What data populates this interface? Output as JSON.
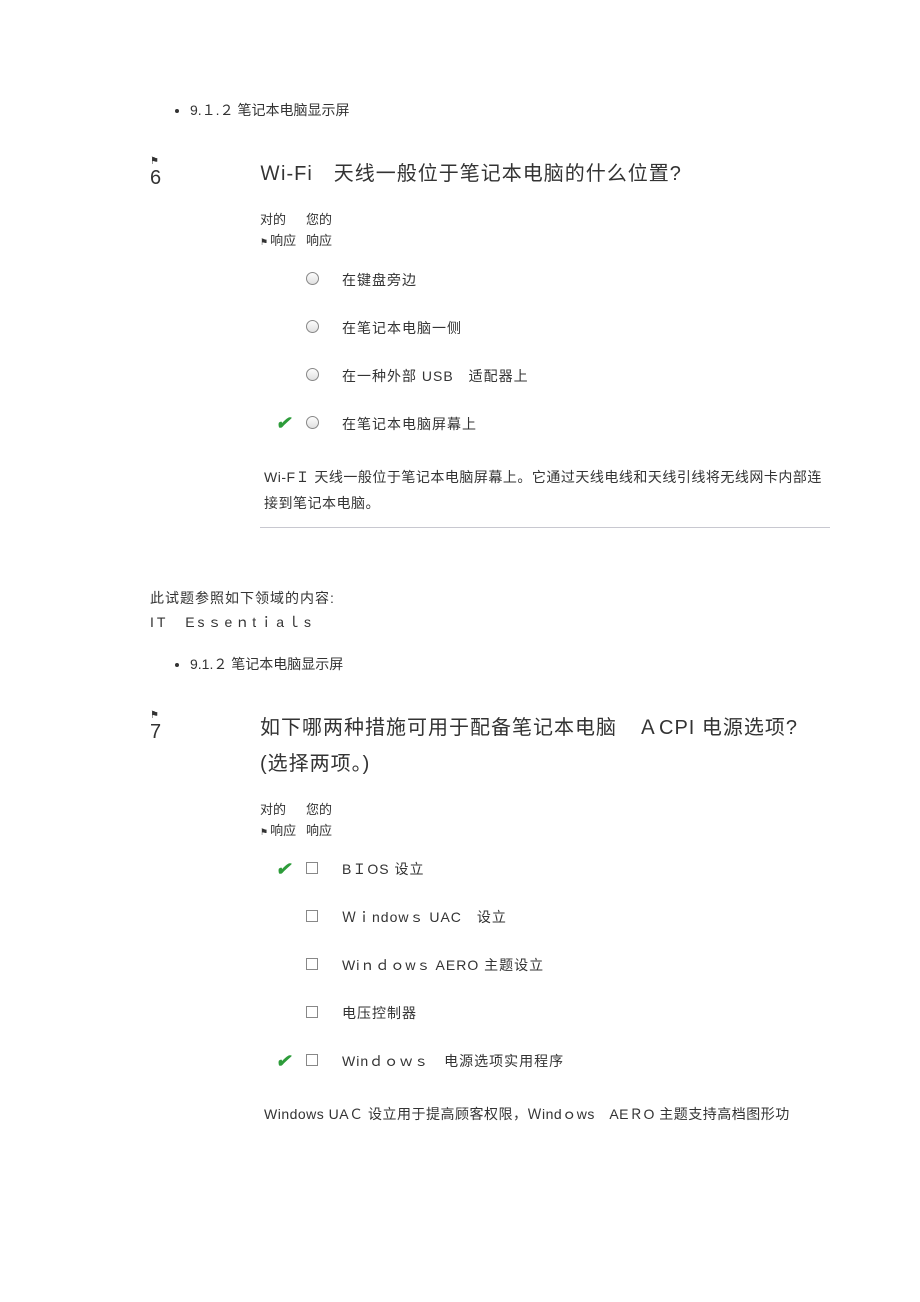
{
  "topBullet": {
    "text": "9.１.２ 笔记本电脑显示屏"
  },
  "q6": {
    "number": "6",
    "title": "Ｗi-Fi　天线一般位于笔记本电脑的什么位置?",
    "headerCorrect": "对的",
    "headerCorrect2": "响应",
    "headerYour": "您的",
    "headerYour2": "响应",
    "options": [
      {
        "correct": false,
        "text": "在键盘旁边"
      },
      {
        "correct": false,
        "text": "在笔记本电脑一侧"
      },
      {
        "correct": false,
        "text": "在一种外部 USB　适配器上"
      },
      {
        "correct": true,
        "text": "在笔记本电脑屏幕上"
      }
    ],
    "explanation": "Wi-FＩ 天线一般位于笔记本电脑屏幕上。它通过天线电线和天线引线将无线网卡内部连接到笔记本电脑。"
  },
  "domain": {
    "intro": "此试题参照如下领域的内容:",
    "subject": "IT　Esｓeｎtｉaｌs",
    "bullet": "9.1.２ 笔记本电脑显示屏"
  },
  "q7": {
    "number": "7",
    "title": "如下哪两种措施可用于配备笔记本电脑　ＡCPI 电源选项?　(选择两项。)",
    "headerCorrect": "对的",
    "headerCorrect2": "响应",
    "headerYour": "您的",
    "headerYour2": "响应",
    "options": [
      {
        "correct": true,
        "text": "BＩOS 设立"
      },
      {
        "correct": false,
        "text": "Ｗｉndowｓ UAC　设立"
      },
      {
        "correct": false,
        "text": "Wiｎｄｏwｓ AERO 主题设立"
      },
      {
        "correct": false,
        "text": "电压控制器"
      },
      {
        "correct": true,
        "text": "Winｄｏｗｓ　电源选项实用程序"
      }
    ],
    "explanation": "Windows UAＣ 设立用于提高顾客权限，Ｗindｏws　AEＲO 主题支持高档图形功"
  }
}
